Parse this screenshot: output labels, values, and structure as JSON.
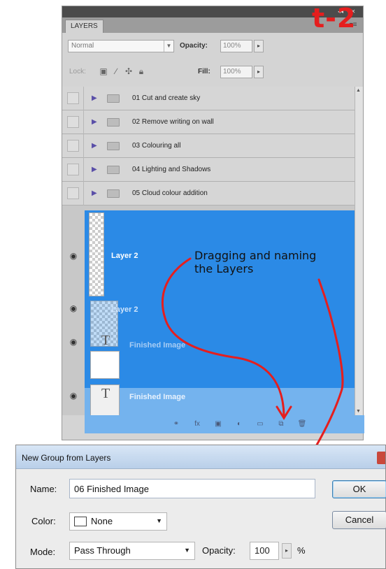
{
  "panel": {
    "tab_label": "LAYERS",
    "menu_icon": "panel-menu-icon",
    "blend_mode": "Normal",
    "opacity_label": "Opacity:",
    "opacity_value": "100%",
    "lock_label": "Lock:",
    "fill_label": "Fill:",
    "fill_value": "100%"
  },
  "groups": [
    {
      "name": "01 Cut and create sky"
    },
    {
      "name": "02 Remove writing on wall"
    },
    {
      "name": "03 Colouring all"
    },
    {
      "name": "04 Lighting and Shadows"
    },
    {
      "name": "05 Cloud colour addition"
    }
  ],
  "layers": [
    {
      "name": "Layer 2"
    },
    {
      "name": "Layer 2"
    },
    {
      "name": "Finished Image"
    },
    {
      "name": "Finished Image"
    }
  ],
  "annotations": {
    "corner_mark": "t-2",
    "note_line1": "Dragging and naming",
    "note_line2": "the Layers",
    "color": "#e51e1e"
  },
  "dialog": {
    "title": "New Group from Layers",
    "name_label": "Name:",
    "name_value": "06 Finished Image",
    "color_label": "Color:",
    "color_value": "None",
    "mode_label": "Mode:",
    "mode_value": "Pass Through",
    "opacity_label": "Opacity:",
    "opacity_value": "100",
    "opacity_unit": "%",
    "ok_label": "OK",
    "cancel_label": "Cancel"
  },
  "colors": {
    "selection_blue": "#2b8ae6",
    "light_blue": "#74b3ee",
    "panel_gray": "#d4d4d4"
  }
}
